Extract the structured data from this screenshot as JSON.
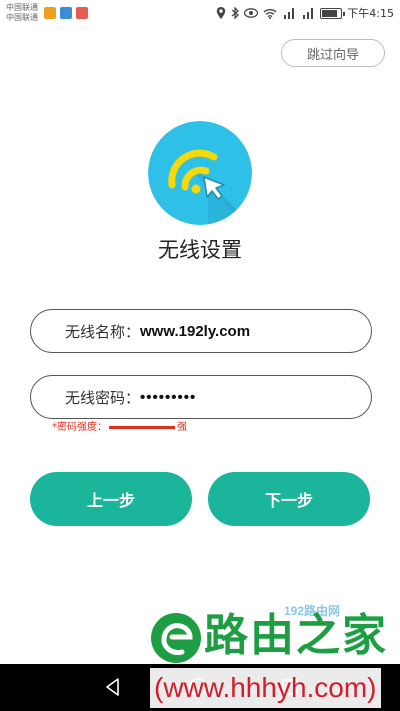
{
  "status_bar": {
    "carrier_1": "中国联通",
    "carrier_2": "中国联通",
    "time": "下午4:15",
    "battery_level_percent": 85,
    "icons": [
      "weibo-icon",
      "telegram-icon",
      "app-icon",
      "location-icon",
      "bluetooth-icon",
      "eye-icon",
      "wifi-icon",
      "4g-signal-icon",
      "signal-icon",
      "battery-icon"
    ]
  },
  "header": {
    "skip_label": "跳过向导"
  },
  "main": {
    "logo_icon": "wifi-cursor-icon",
    "title": "无线设置",
    "ssid": {
      "label": "无线名称：",
      "value": "www.192ly.com"
    },
    "password": {
      "label": "无线密码：",
      "value": "•••••••••"
    },
    "strength": {
      "label": "*密码强度：",
      "level": "强"
    },
    "prev_label": "上一步",
    "next_label": "下一步"
  },
  "watermark": {
    "site_badge": "192路由网",
    "brand": "路由之家",
    "url": "(www.hhhyh.com)"
  },
  "colors": {
    "accent": "#1ab59a",
    "logo_bg": "#2fc0e8",
    "logo_arc": "#f5d90a",
    "strength": "#e0301e",
    "brand_green": "#1e9e43",
    "url_red": "#d21d2c"
  }
}
